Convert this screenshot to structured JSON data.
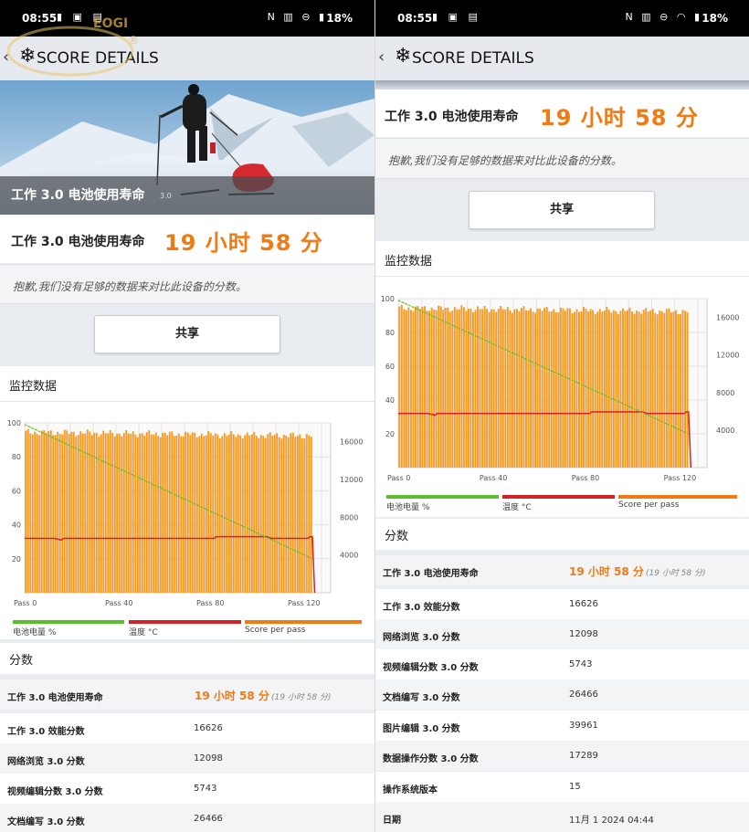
{
  "colors": {
    "accent": "#f07a14",
    "battery_line": "#5cbf2a",
    "temp_line": "#d2232a",
    "bars": "#f59a23"
  },
  "status": {
    "time": "08:55",
    "battery_pct": "18%"
  },
  "app": {
    "back_icon": "back-chevron-icon",
    "logo_icon": "snowflake-icon",
    "title": "SCORE DETAILS"
  },
  "watermark": {
    "text": "EOGI",
    "mark": "®"
  },
  "hero": {
    "title": "工作 3.0 电池使用寿命",
    "version": "3.0"
  },
  "score": {
    "label": "工作 3.0 电池使用寿命",
    "value": "19 小时 58 分"
  },
  "note": "抱歉,我们没有足够的数据来对比此设备的分数。",
  "share_label": "共享",
  "monitor_title": "监控数据",
  "scores_title": "分数",
  "chart_data": {
    "type": "bar",
    "title": "",
    "x_ticks": [
      "Pass 0",
      "Pass 40",
      "Pass 80",
      "Pass 120"
    ],
    "y_left_ticks": [
      "100",
      "80",
      "60",
      "40",
      "20"
    ],
    "y_right_ticks": [
      "16000",
      "12000",
      "8000",
      "4000"
    ],
    "ylim_left": [
      0,
      100
    ],
    "ylim_right": [
      0,
      18000
    ],
    "xlim": [
      0,
      134
    ],
    "grid": true,
    "legend_placement": "bottom",
    "series": [
      {
        "name": "电池电量 %",
        "kind": "line",
        "axis": "left",
        "color": "#5cbf2a",
        "x": [
          0,
          126
        ],
        "values": [
          99,
          20
        ]
      },
      {
        "name": "温度 °C",
        "kind": "line",
        "axis": "left",
        "color": "#d2232a",
        "x": [
          0,
          13,
          16,
          17,
          83,
          84,
          106,
          108,
          124,
          125,
          126,
          127
        ],
        "values": [
          32,
          32,
          31,
          32,
          32,
          33,
          33,
          32,
          32,
          33,
          33,
          0
        ]
      },
      {
        "name": "Score per pass",
        "kind": "bar",
        "axis": "right",
        "color": "#f59a23",
        "bar_count": 126,
        "value_approx": 17000,
        "variation": 400
      }
    ]
  },
  "scores_rows": [
    {
      "label": "工作 3.0 电池使用寿命",
      "value": "19 小时 58 分",
      "sub": "(19 小时 58 分)",
      "highlight": true
    },
    {
      "label": "工作 3.0 效能分数",
      "value": "16626"
    },
    {
      "label": "网络浏览 3.0 分数",
      "value": "12098"
    },
    {
      "label": "视频编辑分数 3.0 分数",
      "value": "5743"
    },
    {
      "label": "文档编写 3.0 分数",
      "value": "26466"
    },
    {
      "label": "图片编辑 3.0 分数",
      "value": "39961"
    },
    {
      "label": "数据操作分数 3.0 分数",
      "value": "17289"
    },
    {
      "label": "操作系统版本",
      "value": "15"
    },
    {
      "label": "日期",
      "value": "11月 1 2024 04:44"
    }
  ]
}
